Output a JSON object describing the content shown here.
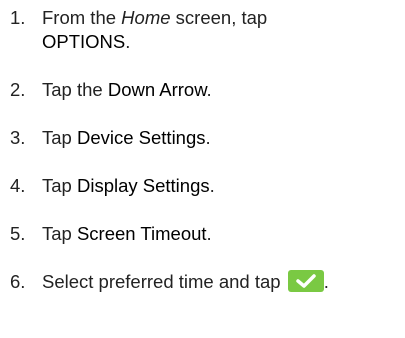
{
  "colors": {
    "text": "#222222",
    "check_button_fill": "#7ac943",
    "check_mark": "#ffffff"
  },
  "steps": [
    {
      "num": "1.",
      "pre": "From the ",
      "emphasis": "Home",
      "mid": " screen, tap",
      "target": "OPTIONS",
      "post": "."
    },
    {
      "num": "2.",
      "pre": "Tap the ",
      "target": "Down Arrow",
      "post": "."
    },
    {
      "num": "3.",
      "pre": "Tap ",
      "target": "Device Settings",
      "post": "."
    },
    {
      "num": "4.",
      "pre": "Tap ",
      "target": "Display Settings",
      "post": "."
    },
    {
      "num": "5.",
      "pre": "Tap ",
      "target": "Screen Timeout",
      "post": "."
    },
    {
      "num": "6.",
      "pre": "Select preferred time and tap ",
      "icon": "check-icon",
      "post": "."
    }
  ]
}
